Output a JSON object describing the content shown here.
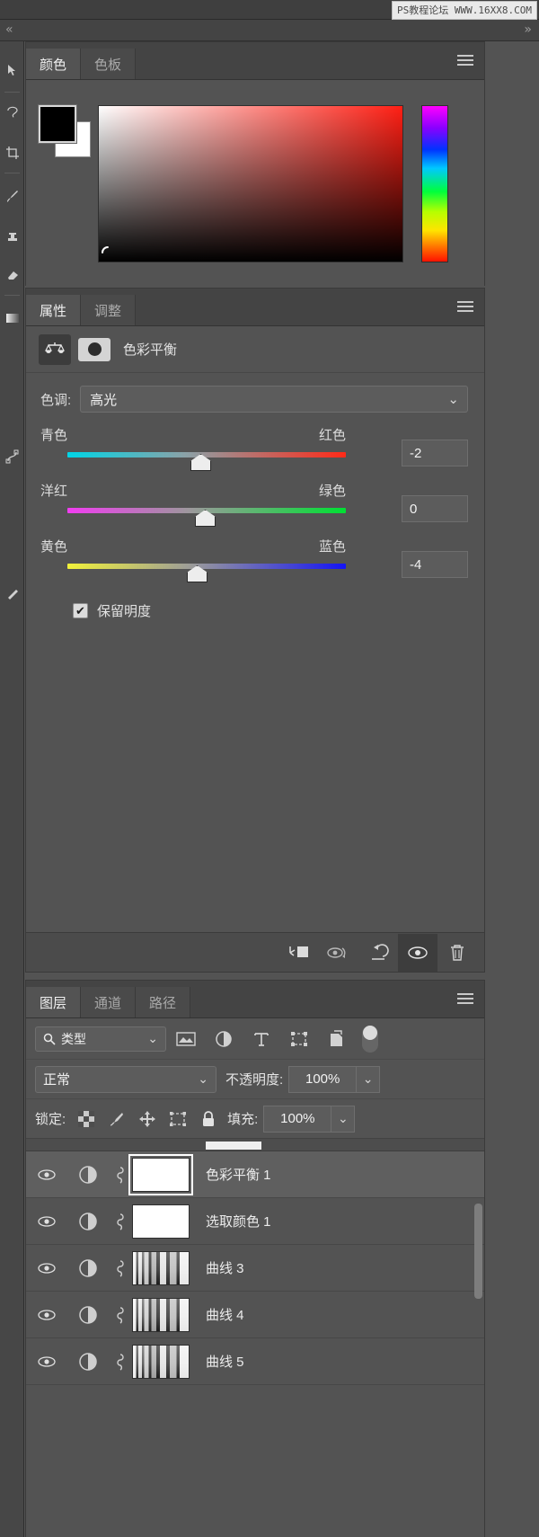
{
  "watermark": "PS教程论坛 WWW.16XX8.COM",
  "collapse": {
    "left": "«",
    "right": "»"
  },
  "color_panel": {
    "tabs": [
      {
        "label": "颜色",
        "active": true
      },
      {
        "label": "色板",
        "active": false
      }
    ],
    "foreground_color": "#000000",
    "background_color": "#ffffff",
    "menu_icon": "hamburger-icon"
  },
  "properties_panel": {
    "tabs": [
      {
        "label": "属性",
        "active": true
      },
      {
        "label": "调整",
        "active": false
      }
    ],
    "adjustment_title": "色彩平衡",
    "adjustment_icon": "color-balance-icon",
    "mask_icon": "layer-mask-icon",
    "tone": {
      "label": "色调:",
      "value": "高光"
    },
    "sliders": [
      {
        "left_label": "青色",
        "right_label": "红色",
        "value": "-2",
        "position_pct": 47
      },
      {
        "left_label": "洋红",
        "right_label": "绿色",
        "value": "0",
        "position_pct": 50
      },
      {
        "left_label": "黄色",
        "right_label": "蓝色",
        "value": "-4",
        "position_pct": 45
      }
    ],
    "preserve_luminosity": {
      "label": "保留明度",
      "checked": true,
      "mark": "✔"
    },
    "footer_buttons": [
      {
        "name": "clip-to-layer-icon",
        "selected": false
      },
      {
        "name": "preview-previous-state-icon",
        "selected": false
      },
      {
        "name": "reset-icon",
        "selected": false
      },
      {
        "name": "visibility-eye-icon",
        "selected": true
      },
      {
        "name": "delete-trash-icon",
        "selected": false
      }
    ]
  },
  "layers_panel": {
    "tabs": [
      {
        "label": "图层",
        "active": true
      },
      {
        "label": "通道",
        "active": false
      },
      {
        "label": "路径",
        "active": false
      }
    ],
    "filter": {
      "label": "类型",
      "icon": "search-icon"
    },
    "filter_icons": [
      "pixel-layer-filter-icon",
      "adjustment-layer-filter-icon",
      "type-layer-filter-icon",
      "shape-layer-filter-icon",
      "smart-object-filter-icon"
    ],
    "filter_toggle": "filter-enable-toggle",
    "blend_mode": "正常",
    "opacity": {
      "label": "不透明度:",
      "value": "100%"
    },
    "lock": {
      "label": "锁定:",
      "icons": [
        "lock-transparency-icon",
        "lock-image-pixels-icon",
        "lock-position-icon",
        "lock-artboard-icon",
        "lock-all-icon"
      ]
    },
    "fill": {
      "label": "填充:",
      "value": "100%"
    },
    "layers": [
      {
        "name": "色彩平衡 1",
        "thumb": "white",
        "selected": true,
        "visible": true,
        "framed": true
      },
      {
        "name": "选取颜色 1",
        "thumb": "white",
        "selected": false,
        "visible": true,
        "framed": false
      },
      {
        "name": "曲线 3",
        "thumb": "photo",
        "selected": false,
        "visible": true,
        "framed": false
      },
      {
        "name": "曲线 4",
        "thumb": "photo",
        "selected": false,
        "visible": true,
        "framed": false
      },
      {
        "name": "曲线 5",
        "thumb": "photo",
        "selected": false,
        "visible": true,
        "framed": false
      }
    ]
  }
}
